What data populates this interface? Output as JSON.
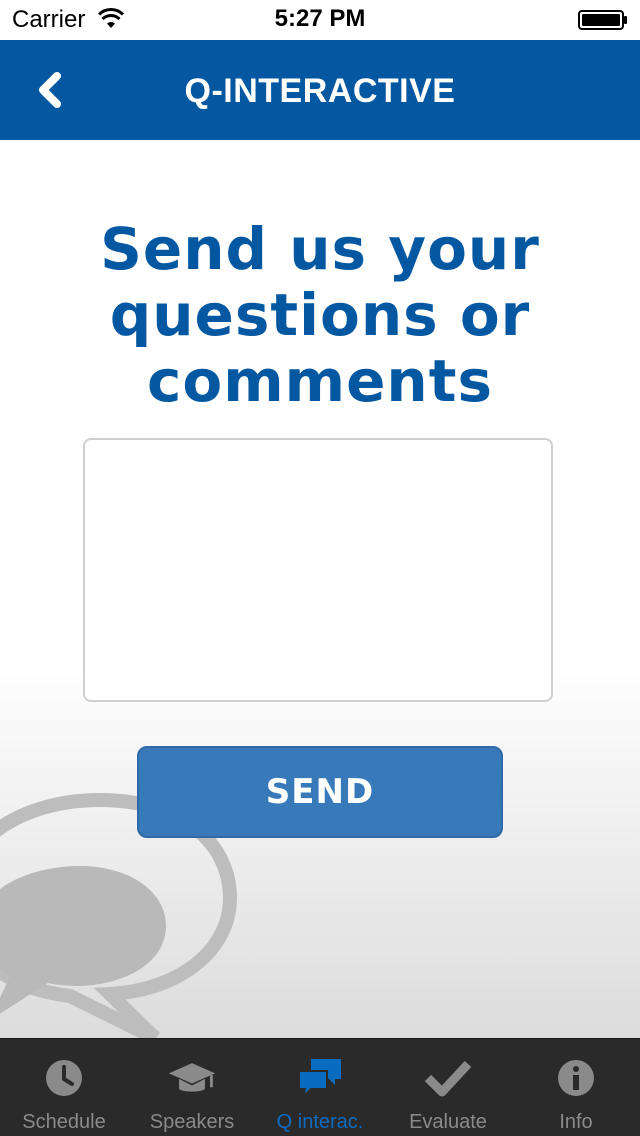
{
  "status_bar": {
    "carrier": "Carrier",
    "time": "5:27 PM"
  },
  "nav": {
    "title": "Q-INTERACTIVE",
    "back_icon": "chevron-left-icon"
  },
  "main": {
    "headline": "Send us your questions or comments",
    "message_value": "",
    "send_label": "SEND"
  },
  "tabs": [
    {
      "label": "Schedule",
      "icon": "clock-icon",
      "active": false
    },
    {
      "label": "Speakers",
      "icon": "graduation-cap-icon",
      "active": false
    },
    {
      "label": "Q interac.",
      "icon": "chat-bubbles-icon",
      "active": true
    },
    {
      "label": "Evaluate",
      "icon": "checkmark-icon",
      "active": false
    },
    {
      "label": "Info",
      "icon": "info-icon",
      "active": false
    }
  ],
  "colors": {
    "brand_blue": "#0458a2",
    "button_blue": "#3879b9",
    "tabbar_bg": "#2a2a2a",
    "tab_inactive": "#8a8a8a",
    "tab_active": "#0a6cc0"
  }
}
